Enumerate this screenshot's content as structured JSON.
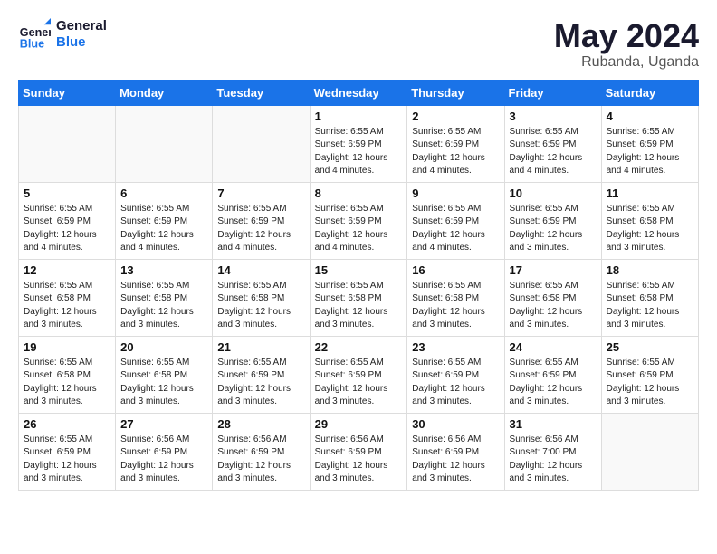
{
  "header": {
    "logo_line1": "General",
    "logo_line2": "Blue",
    "month": "May 2024",
    "location": "Rubanda, Uganda"
  },
  "weekdays": [
    "Sunday",
    "Monday",
    "Tuesday",
    "Wednesday",
    "Thursday",
    "Friday",
    "Saturday"
  ],
  "weeks": [
    [
      {
        "day": "",
        "info": ""
      },
      {
        "day": "",
        "info": ""
      },
      {
        "day": "",
        "info": ""
      },
      {
        "day": "1",
        "info": "Sunrise: 6:55 AM\nSunset: 6:59 PM\nDaylight: 12 hours\nand 4 minutes."
      },
      {
        "day": "2",
        "info": "Sunrise: 6:55 AM\nSunset: 6:59 PM\nDaylight: 12 hours\nand 4 minutes."
      },
      {
        "day": "3",
        "info": "Sunrise: 6:55 AM\nSunset: 6:59 PM\nDaylight: 12 hours\nand 4 minutes."
      },
      {
        "day": "4",
        "info": "Sunrise: 6:55 AM\nSunset: 6:59 PM\nDaylight: 12 hours\nand 4 minutes."
      }
    ],
    [
      {
        "day": "5",
        "info": "Sunrise: 6:55 AM\nSunset: 6:59 PM\nDaylight: 12 hours\nand 4 minutes."
      },
      {
        "day": "6",
        "info": "Sunrise: 6:55 AM\nSunset: 6:59 PM\nDaylight: 12 hours\nand 4 minutes."
      },
      {
        "day": "7",
        "info": "Sunrise: 6:55 AM\nSunset: 6:59 PM\nDaylight: 12 hours\nand 4 minutes."
      },
      {
        "day": "8",
        "info": "Sunrise: 6:55 AM\nSunset: 6:59 PM\nDaylight: 12 hours\nand 4 minutes."
      },
      {
        "day": "9",
        "info": "Sunrise: 6:55 AM\nSunset: 6:59 PM\nDaylight: 12 hours\nand 4 minutes."
      },
      {
        "day": "10",
        "info": "Sunrise: 6:55 AM\nSunset: 6:59 PM\nDaylight: 12 hours\nand 3 minutes."
      },
      {
        "day": "11",
        "info": "Sunrise: 6:55 AM\nSunset: 6:58 PM\nDaylight: 12 hours\nand 3 minutes."
      }
    ],
    [
      {
        "day": "12",
        "info": "Sunrise: 6:55 AM\nSunset: 6:58 PM\nDaylight: 12 hours\nand 3 minutes."
      },
      {
        "day": "13",
        "info": "Sunrise: 6:55 AM\nSunset: 6:58 PM\nDaylight: 12 hours\nand 3 minutes."
      },
      {
        "day": "14",
        "info": "Sunrise: 6:55 AM\nSunset: 6:58 PM\nDaylight: 12 hours\nand 3 minutes."
      },
      {
        "day": "15",
        "info": "Sunrise: 6:55 AM\nSunset: 6:58 PM\nDaylight: 12 hours\nand 3 minutes."
      },
      {
        "day": "16",
        "info": "Sunrise: 6:55 AM\nSunset: 6:58 PM\nDaylight: 12 hours\nand 3 minutes."
      },
      {
        "day": "17",
        "info": "Sunrise: 6:55 AM\nSunset: 6:58 PM\nDaylight: 12 hours\nand 3 minutes."
      },
      {
        "day": "18",
        "info": "Sunrise: 6:55 AM\nSunset: 6:58 PM\nDaylight: 12 hours\nand 3 minutes."
      }
    ],
    [
      {
        "day": "19",
        "info": "Sunrise: 6:55 AM\nSunset: 6:58 PM\nDaylight: 12 hours\nand 3 minutes."
      },
      {
        "day": "20",
        "info": "Sunrise: 6:55 AM\nSunset: 6:58 PM\nDaylight: 12 hours\nand 3 minutes."
      },
      {
        "day": "21",
        "info": "Sunrise: 6:55 AM\nSunset: 6:59 PM\nDaylight: 12 hours\nand 3 minutes."
      },
      {
        "day": "22",
        "info": "Sunrise: 6:55 AM\nSunset: 6:59 PM\nDaylight: 12 hours\nand 3 minutes."
      },
      {
        "day": "23",
        "info": "Sunrise: 6:55 AM\nSunset: 6:59 PM\nDaylight: 12 hours\nand 3 minutes."
      },
      {
        "day": "24",
        "info": "Sunrise: 6:55 AM\nSunset: 6:59 PM\nDaylight: 12 hours\nand 3 minutes."
      },
      {
        "day": "25",
        "info": "Sunrise: 6:55 AM\nSunset: 6:59 PM\nDaylight: 12 hours\nand 3 minutes."
      }
    ],
    [
      {
        "day": "26",
        "info": "Sunrise: 6:55 AM\nSunset: 6:59 PM\nDaylight: 12 hours\nand 3 minutes."
      },
      {
        "day": "27",
        "info": "Sunrise: 6:56 AM\nSunset: 6:59 PM\nDaylight: 12 hours\nand 3 minutes."
      },
      {
        "day": "28",
        "info": "Sunrise: 6:56 AM\nSunset: 6:59 PM\nDaylight: 12 hours\nand 3 minutes."
      },
      {
        "day": "29",
        "info": "Sunrise: 6:56 AM\nSunset: 6:59 PM\nDaylight: 12 hours\nand 3 minutes."
      },
      {
        "day": "30",
        "info": "Sunrise: 6:56 AM\nSunset: 6:59 PM\nDaylight: 12 hours\nand 3 minutes."
      },
      {
        "day": "31",
        "info": "Sunrise: 6:56 AM\nSunset: 7:00 PM\nDaylight: 12 hours\nand 3 minutes."
      },
      {
        "day": "",
        "info": ""
      }
    ]
  ]
}
